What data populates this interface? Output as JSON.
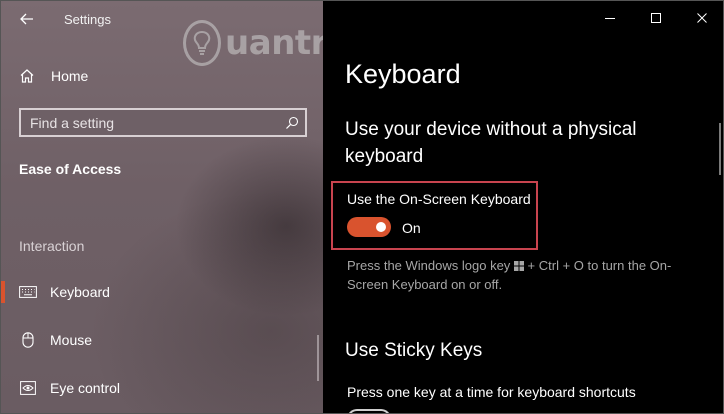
{
  "window": {
    "app_title": "Settings"
  },
  "sidebar": {
    "home_label": "Home",
    "search_placeholder": "Find a setting",
    "category": "Ease of Access",
    "section_label": "Interaction",
    "items": [
      {
        "label": "Keyboard",
        "icon": "keyboard-icon",
        "selected": true
      },
      {
        "label": "Mouse",
        "icon": "mouse-icon",
        "selected": false
      },
      {
        "label": "Eye control",
        "icon": "eye-control-icon",
        "selected": false
      }
    ]
  },
  "watermark": {
    "text": "uantrimang"
  },
  "content": {
    "page_title": "Keyboard",
    "section1_heading": "Use your device without a physical keyboard",
    "osk_toggle": {
      "label": "Use the On-Screen Keyboard",
      "state": "On",
      "value": true
    },
    "description_before_key": "Press the Windows logo key",
    "description_after_key": "+ Ctrl + O to turn the On-Screen Keyboard on or off.",
    "section2_heading": "Use Sticky Keys",
    "sticky_description": "Press one key at a time for keyboard shortcuts"
  },
  "colors": {
    "accent": "#d9532e",
    "highlight_border": "#c9444f",
    "sidebar_bg": "#73646a",
    "content_bg": "#000000",
    "secondary_text": "#a6a6a6"
  }
}
